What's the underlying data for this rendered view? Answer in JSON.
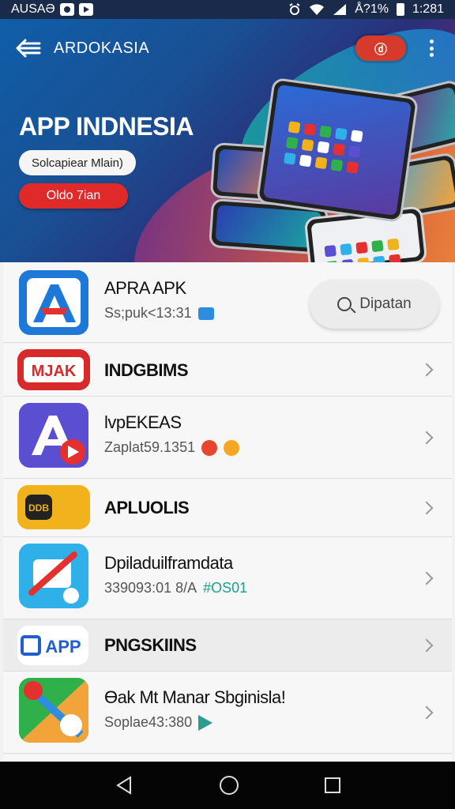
{
  "status_bar": {
    "carrier": "AUSAƏ",
    "battery_text": "Å?1%",
    "time": "1:281"
  },
  "header": {
    "title": "ARDOKASIA",
    "badge": "ⓓ"
  },
  "hero": {
    "title": "APP INDNESIA",
    "pill_label": "Solcapiear Mlain)",
    "cta_label": "Oldo 7ian"
  },
  "search_button": {
    "label": "Dipatan"
  },
  "apps": [
    {
      "title": "APRA APK",
      "sub": "Ss;puk<13:31",
      "colors": [
        "#1e78d8",
        "#e53030"
      ]
    },
    {
      "title": "INDGBIMS",
      "sub": "",
      "colors": [
        "#d82a2a",
        "#ffffff"
      ]
    },
    {
      "title": "lvpEKEAS",
      "sub": "Zaplat59.1351",
      "colors": [
        "#5a4fd0",
        "#e53030"
      ]
    },
    {
      "title": "APLUOLIS",
      "sub": "",
      "colors": [
        "#f2b21c",
        "#222222"
      ]
    },
    {
      "title": "Dpiladuilframdata",
      "sub": "339093:01 8/A",
      "sub_accent": "#OS01",
      "colors": [
        "#2fb0e8",
        "#e53030"
      ]
    },
    {
      "title": "PNGSKIINS",
      "sub": "",
      "colors": [
        "#ffffff",
        "#1f5fd0"
      ]
    },
    {
      "title": "Ɵak Mt Manar Sbginisla!",
      "sub": "Soplae43:380",
      "colors": [
        "#2fb04a",
        "#f2a33a"
      ]
    }
  ],
  "icons": {
    "status": [
      "circle-app-icon",
      "play-app-icon",
      "alarm-icon",
      "wifi-icon",
      "signal-icon",
      "battery-icon"
    ],
    "nav": [
      "nav-back-icon",
      "nav-home-icon",
      "nav-recents-icon"
    ]
  },
  "colors": {
    "accent_red": "#e02a2a",
    "hero_blue": "#0f5ea8",
    "list_bg": "#f7f7f7"
  }
}
